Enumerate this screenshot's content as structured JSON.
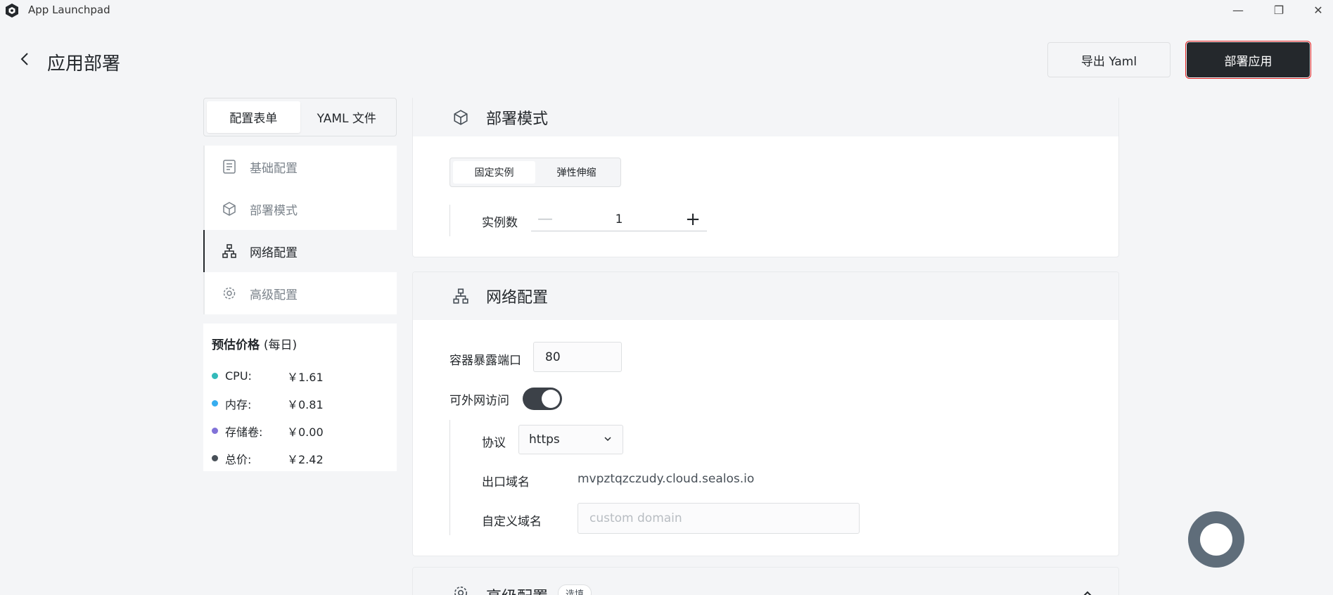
{
  "window": {
    "title": "App Launchpad",
    "controls": {
      "minimize": "—",
      "maximize": "❐",
      "close": "✕"
    }
  },
  "header": {
    "title": "应用部署",
    "export_label": "导出 Yaml",
    "deploy_label": "部署应用"
  },
  "left_tabs": [
    {
      "label": "配置表单",
      "active": true
    },
    {
      "label": "YAML 文件",
      "active": false
    }
  ],
  "nav": [
    {
      "label": "基础配置",
      "icon": "document-icon"
    },
    {
      "label": "部署模式",
      "icon": "cube-icon"
    },
    {
      "label": "网络配置",
      "icon": "network-icon",
      "active": true
    },
    {
      "label": "高级配置",
      "icon": "gear-icon"
    }
  ],
  "price": {
    "title": "预估价格",
    "subtitle": "(每日)",
    "rows": [
      {
        "label": "CPU:",
        "value": "￥1.61",
        "color": "#33bababa"
      },
      {
        "label": "内存:",
        "value": "￥0.81",
        "color": "#36adef"
      },
      {
        "label": "存储卷:",
        "value": "￥0.00",
        "color": "#8172d8"
      },
      {
        "label": "总价:",
        "value": "￥2.42",
        "color": "#485058"
      }
    ]
  },
  "deploy_mode": {
    "title": "部署模式",
    "options": [
      {
        "label": "固定实例",
        "active": true
      },
      {
        "label": "弹性伸缩",
        "active": false
      }
    ],
    "instances_label": "实例数",
    "instances_value": "1",
    "minus": "—",
    "plus": "+"
  },
  "network": {
    "title": "网络配置",
    "port_label": "容器暴露端口",
    "port_value": "80",
    "public_label": "可外网访问",
    "public_enabled": true,
    "protocol_label": "协议",
    "protocol_value": "https",
    "domain_label": "出口域名",
    "domain_value": "mvpztqzczudy.cloud.sealos.io",
    "custom_domain_label": "自定义域名",
    "custom_domain_placeholder": "custom domain"
  },
  "advanced": {
    "title": "高级配置",
    "badge": "选填"
  }
}
